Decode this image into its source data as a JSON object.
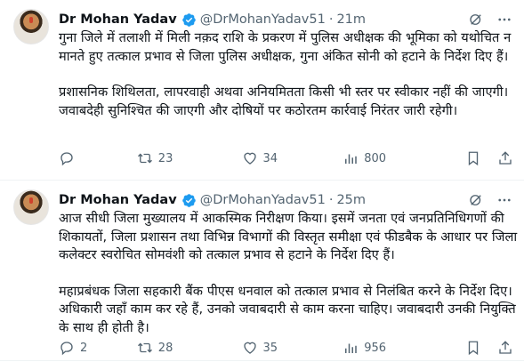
{
  "tweets": [
    {
      "name": "Dr Mohan Yadav",
      "handle": "@DrMohanYadav51",
      "time": "21m",
      "paragraphs": [
        "गुना जिले में तलाशी में मिली नक़द राशि के प्रकरण में पुलिस अधीक्षक की भूमिका को यथोचित न मानते हुए तत्काल प्रभाव से जिला पुलिस अधीक्षक, गुना अंकित सोनी को हटाने के निर्देश दिए हैं।",
        "प्रशासनिक शिथिलता, लापरवाही अथवा अनियमितता किसी भी स्तर पर स्वीकार नहीं की जाएगी। जवाबदेही सुनिश्चित की जाएगी और दोषियों पर कठोरतम कार्रवाई निरंतर जारी रहेगी।"
      ],
      "replies": "",
      "retweets": "23",
      "likes": "34",
      "views": "800"
    },
    {
      "name": "Dr Mohan Yadav",
      "handle": "@DrMohanYadav51",
      "time": "25m",
      "paragraphs": [
        "आज सीधी जिला मुख्यालय में आकस्मिक निरीक्षण किया। इसमें जनता एवं जनप्रतिनिधिगणों की शिकायतों, जिला प्रशासन तथा विभिन्न विभागों की विस्तृत समीक्षा एवं फीडबैक के आधार पर जिला कलेक्टर स्वरोचित सोमवंशी को तत्काल प्रभाव से हटाने के निर्देश दिए हैं।",
        "महाप्रबंधक जिला सहकारी बैंक पीएस धनवाल को तत्काल प्रभाव से निलंबित करने के निर्देश दिए। अधिकारी जहाँ काम कर रहे हैं, उनको जवाबदारी से काम करना चाहिए। जवाबदारी उनकी नियुक्ति के साथ ही होती है।"
      ],
      "replies": "2",
      "retweets": "28",
      "likes": "35",
      "views": "956"
    }
  ],
  "icons": {
    "verified": "verified-badge-icon",
    "grok": "grok-icon",
    "more": "more-icon",
    "reply": "reply-icon",
    "retweet": "retweet-icon",
    "like": "heart-icon",
    "views": "views-icon",
    "bookmark": "bookmark-icon",
    "share": "share-icon"
  },
  "colors": {
    "verified": "#1d9bf0",
    "muted": "#536471",
    "text": "#0f1419"
  }
}
